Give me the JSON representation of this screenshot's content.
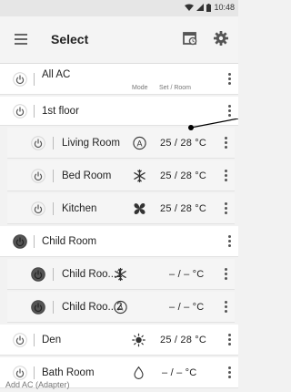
{
  "status_bar": {
    "time": "10:48"
  },
  "app_bar": {
    "title": "Select"
  },
  "column_headers": {
    "mode": "Mode",
    "set_room": "Set / Room"
  },
  "rows": [
    {
      "id": "all-ac",
      "label": "All AC",
      "power": "off",
      "mode_icon": "none",
      "temp": ""
    },
    {
      "id": "1st-floor",
      "label": "1st floor",
      "power": "off",
      "mode_icon": "none",
      "temp": ""
    },
    {
      "id": "living-room",
      "label": "Living Room",
      "power": "off",
      "mode_icon": "auto-mode-icon",
      "temp": "25 / 28 °C"
    },
    {
      "id": "bed-room",
      "label": "Bed Room",
      "power": "off",
      "mode_icon": "snowflake-icon",
      "temp": "25 / 28 °C"
    },
    {
      "id": "kitchen",
      "label": "Kitchen",
      "power": "off",
      "mode_icon": "fan-icon",
      "temp": "25 / 28 °C"
    },
    {
      "id": "child-room",
      "label": "Child Room",
      "power": "on",
      "mode_icon": "none",
      "temp": ""
    },
    {
      "id": "child-room-1",
      "label": "Child Roo...1",
      "power": "on",
      "mode_icon": "snowflake-icon",
      "temp": "– / –   °C"
    },
    {
      "id": "child-room-2",
      "label": "Child Roo...2",
      "power": "on",
      "mode_icon": "auto-mode-icon",
      "temp": "– / –   °C"
    },
    {
      "id": "den",
      "label": "Den",
      "power": "off",
      "mode_icon": "sun-icon",
      "temp": "25 / 28 °C"
    },
    {
      "id": "bath-room",
      "label": "Bath Room",
      "power": "off",
      "mode_icon": "droplet-icon",
      "temp": "– / –   °C"
    }
  ],
  "footer": {
    "add_ac": "Add AC (Adapter)"
  }
}
